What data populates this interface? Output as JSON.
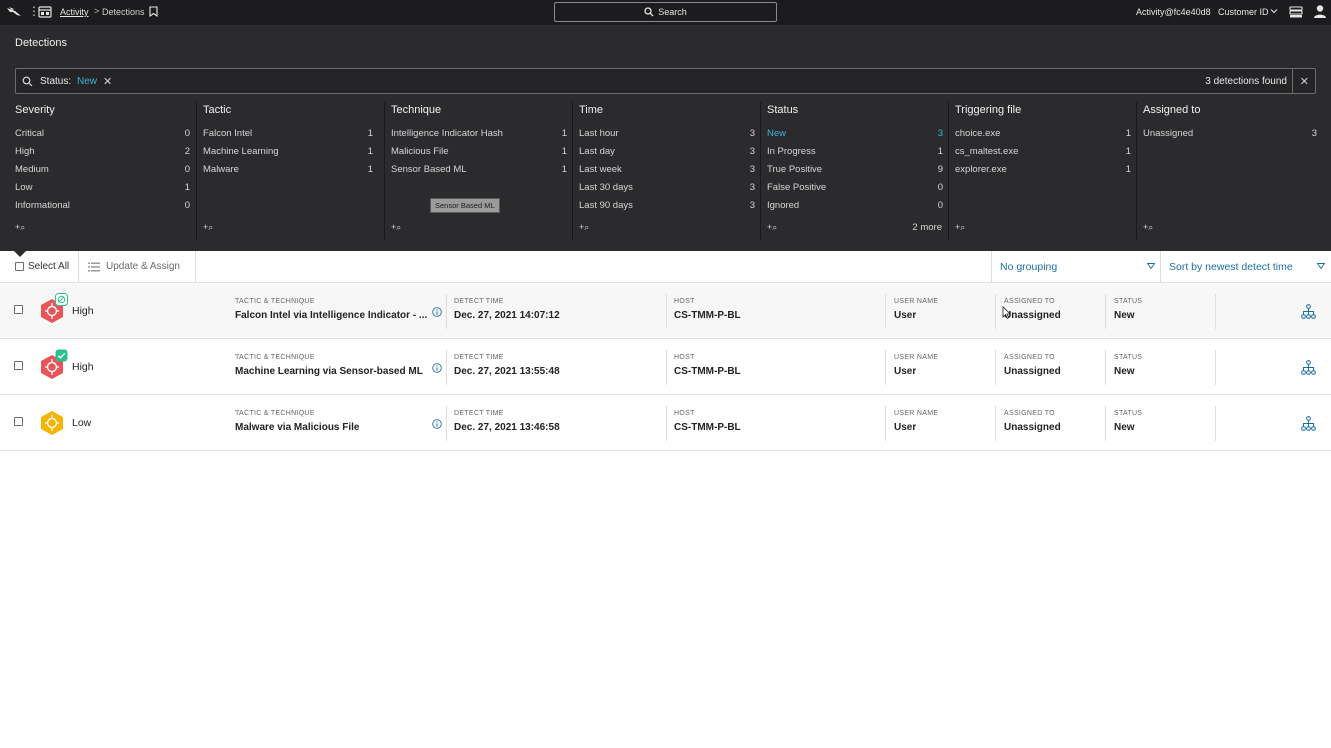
{
  "topbar": {
    "breadcrumb_activity": "Activity",
    "breadcrumb_sep": ">",
    "breadcrumb_current": "Detections",
    "search_label": "Search",
    "user": "Activity@fc4e40d8",
    "customer": "Customer ID"
  },
  "page": {
    "title": "Detections"
  },
  "filter": {
    "label": "Status:",
    "value": "New",
    "remove": "✕",
    "count": "3 detections found",
    "close": "✕"
  },
  "facets": {
    "severity": {
      "title": "Severity",
      "rows": [
        {
          "label": "Critical",
          "count": "0"
        },
        {
          "label": "High",
          "count": "2"
        },
        {
          "label": "Medium",
          "count": "0"
        },
        {
          "label": "Low",
          "count": "1"
        },
        {
          "label": "Informational",
          "count": "0"
        }
      ],
      "search": "+⌕"
    },
    "tactic": {
      "title": "Tactic",
      "rows": [
        {
          "label": "Falcon Intel",
          "count": "1"
        },
        {
          "label": "Machine Learning",
          "count": "1"
        },
        {
          "label": "Malware",
          "count": "1"
        }
      ],
      "search": "+⌕"
    },
    "technique": {
      "title": "Technique",
      "rows": [
        {
          "label": "Intelligence Indicator Hash",
          "count": "1"
        },
        {
          "label": "Malicious File",
          "count": "1"
        },
        {
          "label": "Sensor Based ML",
          "count": "1"
        }
      ],
      "search": "+⌕",
      "tooltip": "Sensor Based ML"
    },
    "time": {
      "title": "Time",
      "rows": [
        {
          "label": "Last hour",
          "count": "3"
        },
        {
          "label": "Last day",
          "count": "3"
        },
        {
          "label": "Last week",
          "count": "3"
        },
        {
          "label": "Last 30 days",
          "count": "3"
        },
        {
          "label": "Last 90 days",
          "count": "3"
        }
      ],
      "search": "+⌕"
    },
    "status": {
      "title": "Status",
      "rows": [
        {
          "label": "New",
          "count": "3"
        },
        {
          "label": "In Progress",
          "count": "1"
        },
        {
          "label": "True Positive",
          "count": "9"
        },
        {
          "label": "False Positive",
          "count": "0"
        },
        {
          "label": "Ignored",
          "count": "0"
        }
      ],
      "search": "+⌕",
      "more": "2 more"
    },
    "triggering": {
      "title": "Triggering file",
      "rows": [
        {
          "label": "choice.exe",
          "count": "1"
        },
        {
          "label": "cs_maltest.exe",
          "count": "1"
        },
        {
          "label": "explorer.exe",
          "count": "1"
        }
      ],
      "search": "+⌕"
    },
    "assigned": {
      "title": "Assigned to",
      "rows": [
        {
          "label": "Unassigned",
          "count": "3"
        }
      ],
      "search": "+⌕"
    }
  },
  "toolbar": {
    "select_all": "Select All",
    "update_assign": "Update & Assign",
    "grouping": "No grouping",
    "sort": "Sort by newest detect time"
  },
  "labels": {
    "tactic": "TACTIC & TECHNIQUE",
    "detect_time": "DETECT TIME",
    "host": "HOST",
    "user": "USER NAME",
    "assigned": "ASSIGNED TO",
    "status": "STATUS"
  },
  "detections": [
    {
      "severity": "High",
      "severity_color": "#e8545a",
      "badge": "shield",
      "tactic": "Falcon Intel via Intelligence Indicator - ...",
      "time": "Dec. 27, 2021 14:07:12",
      "host": "CS-TMM-P-BL",
      "user": "User",
      "assigned": "Unassigned",
      "status": "New"
    },
    {
      "severity": "High",
      "severity_color": "#e8545a",
      "badge": "check",
      "tactic": "Machine Learning via Sensor-based ML",
      "time": "Dec. 27, 2021 13:55:48",
      "host": "CS-TMM-P-BL",
      "user": "User",
      "assigned": "Unassigned",
      "status": "New"
    },
    {
      "severity": "Low",
      "severity_color": "#f4b400",
      "badge": "",
      "tactic": "Malware via Malicious File",
      "time": "Dec. 27, 2021 13:46:58",
      "host": "CS-TMM-P-BL",
      "user": "User",
      "assigned": "Unassigned",
      "status": "New"
    }
  ],
  "colors": {
    "accent": "#39b3d6",
    "link": "#1d6fa3",
    "high": "#e8545a",
    "low": "#f4b400",
    "badge_green": "#2dbf8f"
  }
}
